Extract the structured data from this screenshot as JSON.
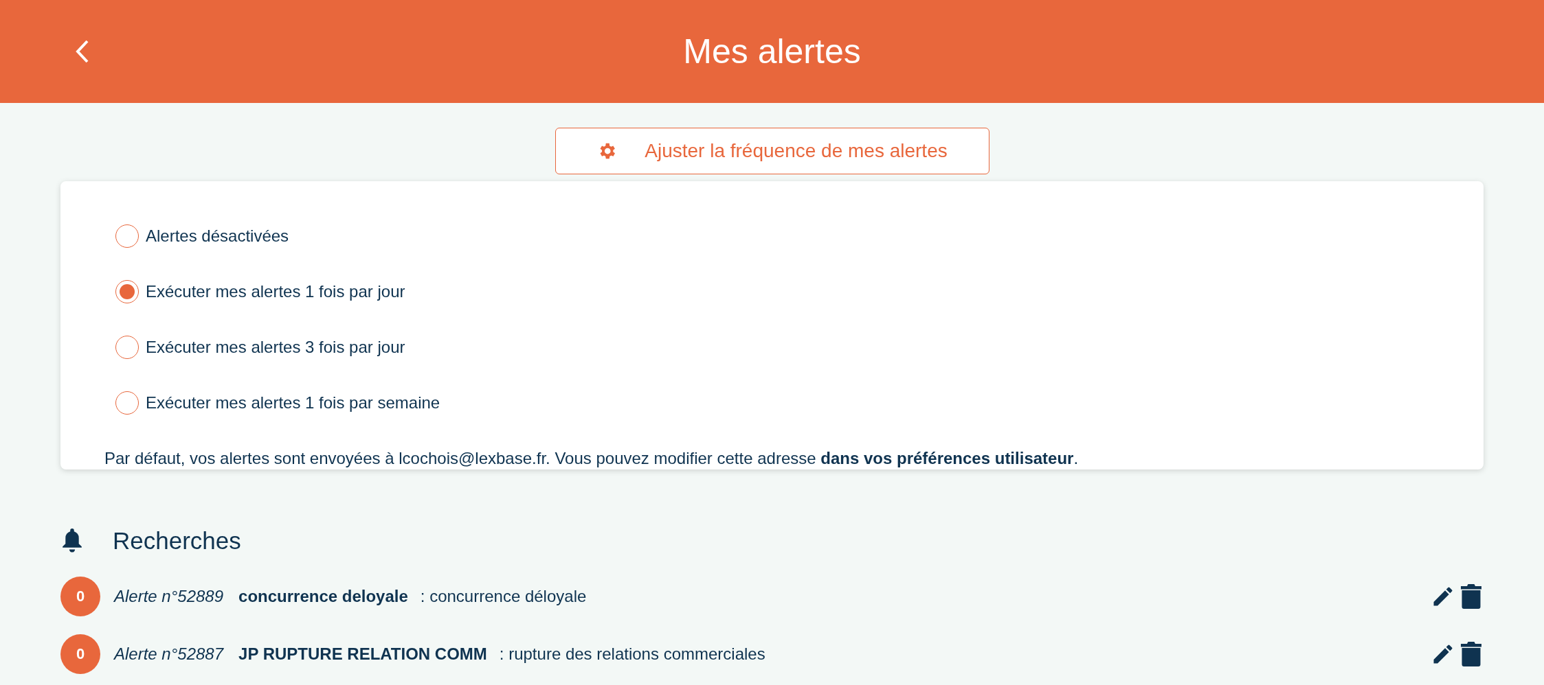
{
  "header": {
    "title": "Mes alertes"
  },
  "frequency_button": {
    "label": "Ajuster la fréquence de mes alertes"
  },
  "frequency_options": [
    {
      "label": "Alertes désactivées",
      "selected": false
    },
    {
      "label": "Exécuter mes alertes 1 fois par jour",
      "selected": true
    },
    {
      "label": "Exécuter mes alertes 3 fois par jour",
      "selected": false
    },
    {
      "label": "Exécuter mes alertes 1 fois par semaine",
      "selected": false
    }
  ],
  "note": {
    "text": "Par défaut, vos alertes sont envoyées à lcochois@lexbase.fr. Vous pouvez modifier cette adresse ",
    "link": "dans vos préférences utilisateur",
    "end": "."
  },
  "section": {
    "title": "Recherches"
  },
  "alerts": [
    {
      "count": "0",
      "number": "Alerte n°52889",
      "name": "concurrence deloyale",
      "query": ": concurrence déloyale"
    },
    {
      "count": "0",
      "number": "Alerte n°52887",
      "name": "JP RUPTURE RELATION COMM",
      "query": ": rupture des relations commerciales"
    }
  ]
}
